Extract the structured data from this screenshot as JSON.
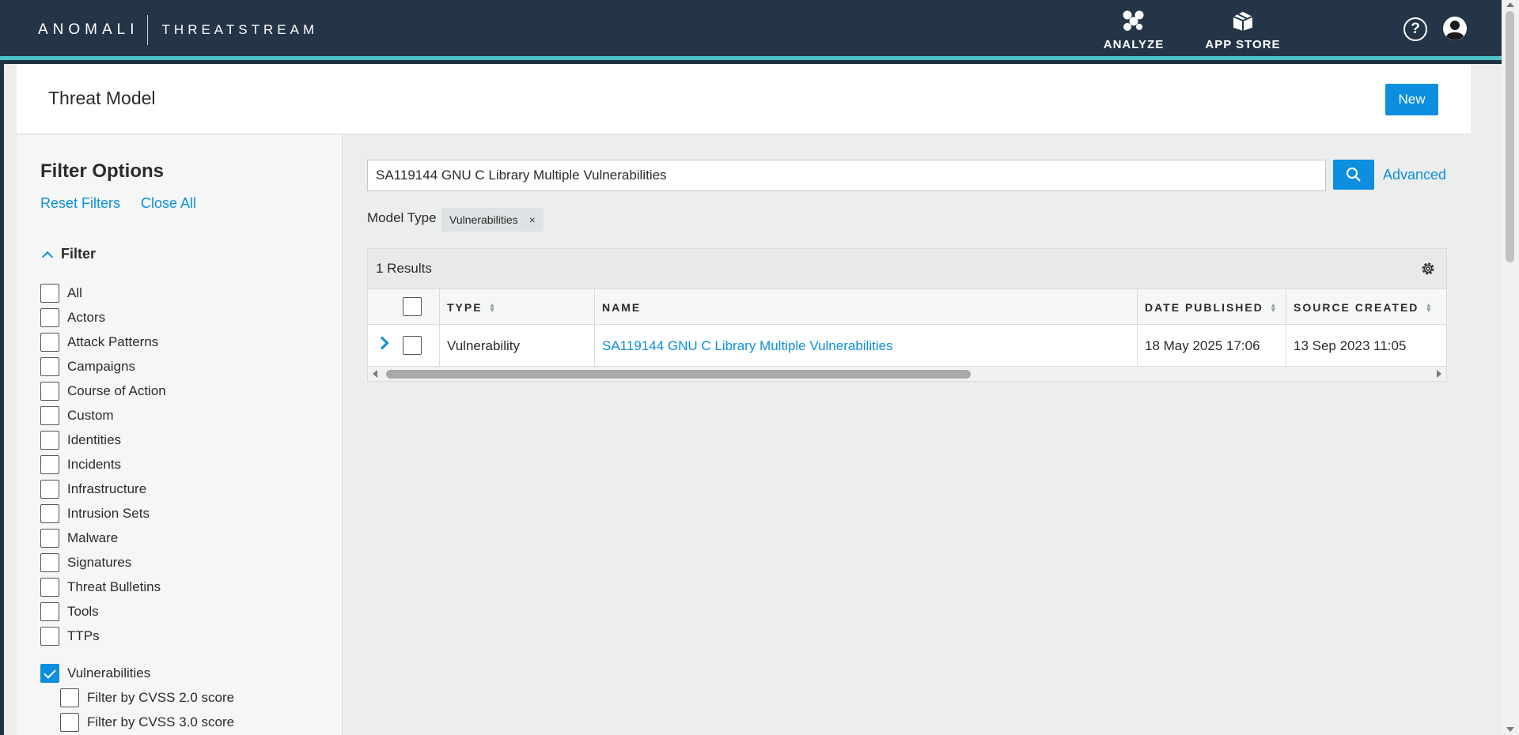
{
  "header": {
    "brand": "ANOMALI",
    "product": "THREATSTREAM",
    "nav": [
      {
        "label": "ANALYZE",
        "icon": "analyze-icon"
      },
      {
        "label": "APP STORE",
        "icon": "app-store-icon"
      }
    ],
    "help_glyph": "?",
    "colors": {
      "bar": "#243547",
      "accent_stripe": "#4dc1c6"
    }
  },
  "page": {
    "title": "Threat Model",
    "new_button": "New"
  },
  "sidebar": {
    "title": "Filter Options",
    "reset_label": "Reset Filters",
    "close_label": "Close All",
    "section_label": "Filter",
    "options": [
      {
        "label": "All",
        "checked": false
      },
      {
        "label": "Actors",
        "checked": false
      },
      {
        "label": "Attack Patterns",
        "checked": false
      },
      {
        "label": "Campaigns",
        "checked": false
      },
      {
        "label": "Course of Action",
        "checked": false
      },
      {
        "label": "Custom",
        "checked": false
      },
      {
        "label": "Identities",
        "checked": false
      },
      {
        "label": "Incidents",
        "checked": false
      },
      {
        "label": "Infrastructure",
        "checked": false
      },
      {
        "label": "Intrusion Sets",
        "checked": false
      },
      {
        "label": "Malware",
        "checked": false
      },
      {
        "label": "Signatures",
        "checked": false
      },
      {
        "label": "Threat Bulletins",
        "checked": false
      },
      {
        "label": "Tools",
        "checked": false
      },
      {
        "label": "TTPs",
        "checked": false
      },
      {
        "label": "Vulnerabilities",
        "checked": true
      }
    ],
    "sub_options": [
      {
        "label": "Filter by CVSS 2.0 score",
        "checked": false
      },
      {
        "label": "Filter by CVSS 3.0 score",
        "checked": false
      }
    ]
  },
  "search": {
    "value": "SA119144 GNU C Library Multiple Vulnerabilities",
    "advanced_label": "Advanced"
  },
  "model_type": {
    "label": "Model Type",
    "chip": "Vulnerabilities",
    "chip_remove": "×"
  },
  "results": {
    "count_label": "1 Results",
    "columns": [
      "TYPE",
      "NAME",
      "DATE PUBLISHED",
      "SOURCE CREATED"
    ],
    "rows": [
      {
        "type": "Vulnerability",
        "name": "SA119144 GNU C Library Multiple Vulnerabilities",
        "date_published": "18 May 2025 17:06",
        "source_created": "13 Sep 2023 11:05"
      }
    ]
  },
  "accent_color": "#0d8ede"
}
